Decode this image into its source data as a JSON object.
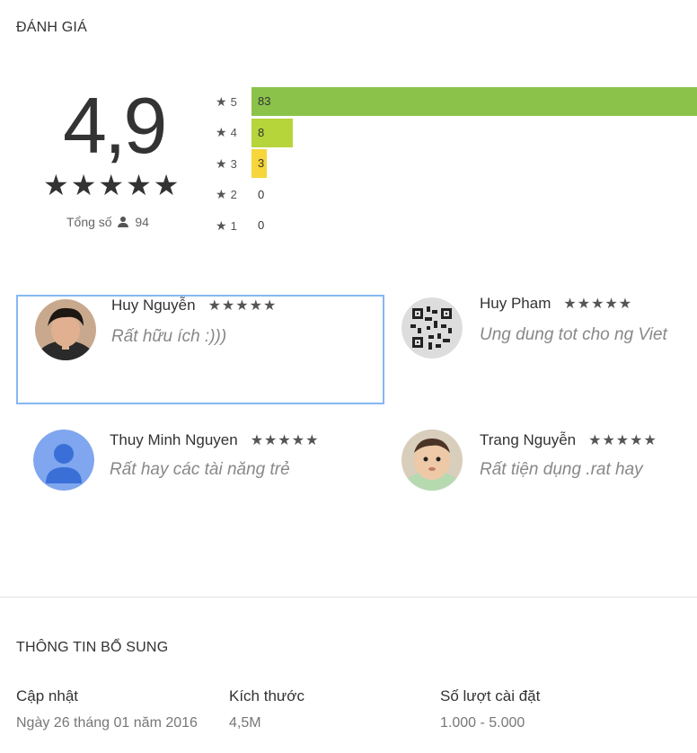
{
  "rating_section": {
    "title": "ĐÁNH GIÁ",
    "score": "4,9",
    "stars": "★★★★★",
    "total_label": "Tổng số",
    "total_count": "94"
  },
  "histogram": [
    {
      "star": "5",
      "count": "83",
      "fraction": 1.0,
      "color": "#8bc34a"
    },
    {
      "star": "4",
      "count": "8",
      "fraction": 0.092,
      "color": "#b6d53a"
    },
    {
      "star": "3",
      "count": "3",
      "fraction": 0.034,
      "color": "#f6d63a"
    },
    {
      "star": "2",
      "count": "0",
      "fraction": 0,
      "color": "#cccccc"
    },
    {
      "star": "1",
      "count": "0",
      "fraction": 0,
      "color": "#cccccc"
    }
  ],
  "reviews": [
    {
      "name": "Huy Nguyễn",
      "stars": "★★★★★",
      "text": "Rất hữu ích :)))"
    },
    {
      "name": "Huy Pham",
      "stars": "★★★★★",
      "text": "Ung dung tot cho ng Viet"
    },
    {
      "name": "Thuy Minh Nguyen",
      "stars": "★★★★★",
      "text": "Rất hay các tài năng trẻ"
    },
    {
      "name": "Trang Nguyễn",
      "stars": "★★★★★",
      "text": "Rất tiện dụng .rat hay"
    }
  ],
  "info_section": {
    "title": "THÔNG TIN BỔ SUNG",
    "updated_label": "Cập nhật",
    "updated_value": "Ngày 26 tháng 01 năm 2016",
    "size_label": "Kích thước",
    "size_value": "4,5M",
    "installs_label": "Số lượt cài đặt",
    "installs_value": "1.000 - 5.000"
  }
}
